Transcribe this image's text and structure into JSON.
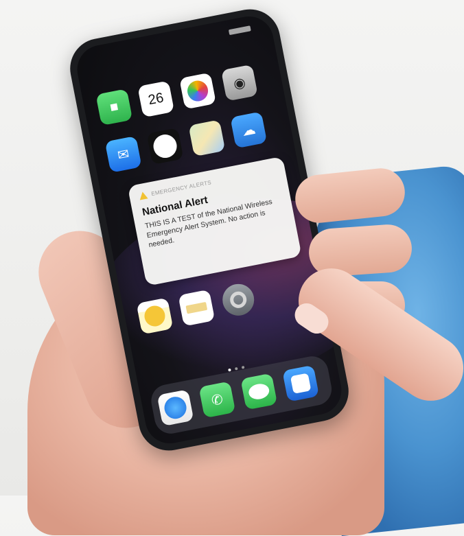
{
  "alert": {
    "header": "EMERGENCY ALERTS",
    "title": "National Alert",
    "body": "THIS IS A TEST of the National Wireless Emergency Alert System. No action is needed."
  },
  "home_screen": {
    "calendar_date": "26",
    "row1": [
      "FaceTime",
      "Calendar",
      "Photos",
      "Camera"
    ],
    "row2": [
      "Mail",
      "Clock",
      "Maps",
      "Weather"
    ],
    "row4": [
      "Notes",
      "Reminders",
      "Settings"
    ]
  },
  "dock": [
    "Safari",
    "Phone",
    "Messages",
    "Music"
  ],
  "colors": {
    "sleeve": "#4a93d0",
    "skin": "#e9b5a2",
    "phone_body": "#1b1c1f",
    "alert_icon": "#f1c232"
  },
  "icons": [
    "warning-icon",
    "facetime-icon",
    "calendar-icon",
    "photos-icon",
    "camera-icon",
    "mail-icon",
    "clock-icon",
    "maps-icon",
    "weather-icon",
    "notes-icon",
    "reminders-icon",
    "settings-icon",
    "safari-icon",
    "phone-icon",
    "messages-icon",
    "music-icon"
  ]
}
